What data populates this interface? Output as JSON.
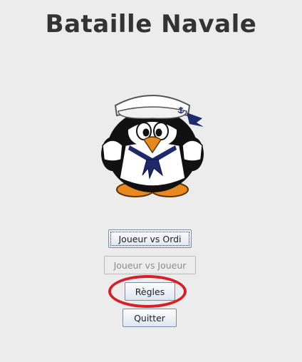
{
  "window": {
    "title": "Bataille Navale"
  },
  "menu": {
    "buttons": [
      {
        "id": "joueur-vs-ordi",
        "label": "Joueur vs Ordi",
        "enabled": true,
        "focused": true
      },
      {
        "id": "joueur-vs-joueur",
        "label": "Joueur vs Joueur",
        "enabled": false,
        "focused": false
      },
      {
        "id": "regles",
        "label": "Règles",
        "enabled": true,
        "focused": false,
        "highlighted": true
      },
      {
        "id": "quitter",
        "label": "Quitter",
        "enabled": true,
        "focused": false
      }
    ]
  },
  "mascot": {
    "subject": "sailor-penguin",
    "hat_emblem": "anchor-icon"
  },
  "colors": {
    "background": "#ececec",
    "title": "#333333",
    "highlight": "#d61f26",
    "button_border": "#7a8ba3",
    "disabled_text": "#8c8c8c"
  }
}
